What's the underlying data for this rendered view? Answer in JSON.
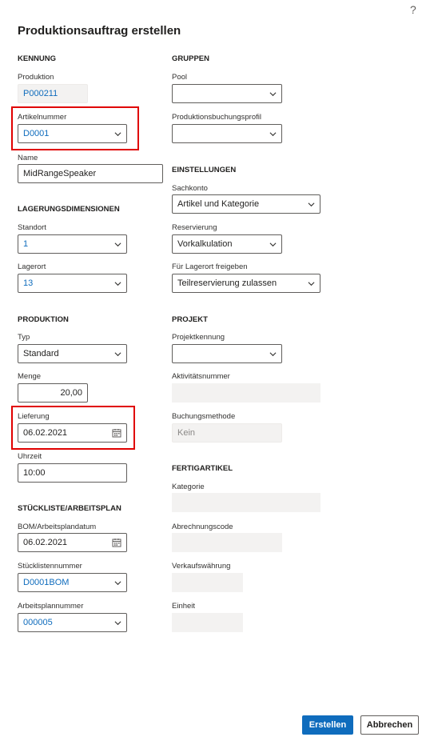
{
  "help_icon": "?",
  "title": "Produktionsauftrag erstellen",
  "kennung": {
    "heading": "KENNUNG",
    "produktion": {
      "label": "Produktion",
      "value": "P000211"
    },
    "artikelnummer": {
      "label": "Artikelnummer",
      "value": "D0001"
    },
    "name": {
      "label": "Name",
      "value": "MidRangeSpeaker"
    }
  },
  "lagerung": {
    "heading": "LAGERUNGSDIMENSIONEN",
    "standort": {
      "label": "Standort",
      "value": "1"
    },
    "lagerort": {
      "label": "Lagerort",
      "value": "13"
    }
  },
  "produktion": {
    "heading": "PRODUKTION",
    "typ": {
      "label": "Typ",
      "value": "Standard"
    },
    "menge": {
      "label": "Menge",
      "value": "20,00"
    },
    "lieferung": {
      "label": "Lieferung",
      "value": "06.02.2021"
    },
    "uhrzeit": {
      "label": "Uhrzeit",
      "value": "10:00"
    }
  },
  "stueckliste": {
    "heading": "STÜCKLISTE/ARBEITSPLAN",
    "bom_datum": {
      "label": "BOM/Arbeitsplandatum",
      "value": "06.02.2021"
    },
    "stuecklistennummer": {
      "label": "Stücklistennummer",
      "value": "D0001BOM"
    },
    "arbeitsplannummer": {
      "label": "Arbeitsplannummer",
      "value": "000005"
    }
  },
  "gruppen": {
    "heading": "GRUPPEN",
    "pool": {
      "label": "Pool",
      "value": ""
    },
    "produktionsbuchungsprofil": {
      "label": "Produktionsbuchungsprofil",
      "value": ""
    }
  },
  "einstellungen": {
    "heading": "EINSTELLUNGEN",
    "sachkonto": {
      "label": "Sachkonto",
      "value": "Artikel und Kategorie"
    },
    "reservierung": {
      "label": "Reservierung",
      "value": "Vorkalkulation"
    },
    "freigeben": {
      "label": "Für Lagerort freigeben",
      "value": "Teilreservierung zulassen"
    }
  },
  "projekt": {
    "heading": "PROJEKT",
    "projektkennung": {
      "label": "Projektkennung",
      "value": ""
    },
    "aktivitaetsnummer": {
      "label": "Aktivitätsnummer",
      "value": ""
    },
    "buchungsmethode": {
      "label": "Buchungsmethode",
      "value": "Kein"
    }
  },
  "fertigartikel": {
    "heading": "FERTIGARTIKEL",
    "kategorie": {
      "label": "Kategorie",
      "value": ""
    },
    "abrechnungscode": {
      "label": "Abrechnungscode",
      "value": ""
    },
    "verkaufswaehrung": {
      "label": "Verkaufswährung",
      "value": ""
    },
    "einheit": {
      "label": "Einheit",
      "value": ""
    }
  },
  "buttons": {
    "create": "Erstellen",
    "cancel": "Abbrechen"
  },
  "colors": {
    "accent": "#0f6cbd",
    "highlight": "#e00000"
  }
}
